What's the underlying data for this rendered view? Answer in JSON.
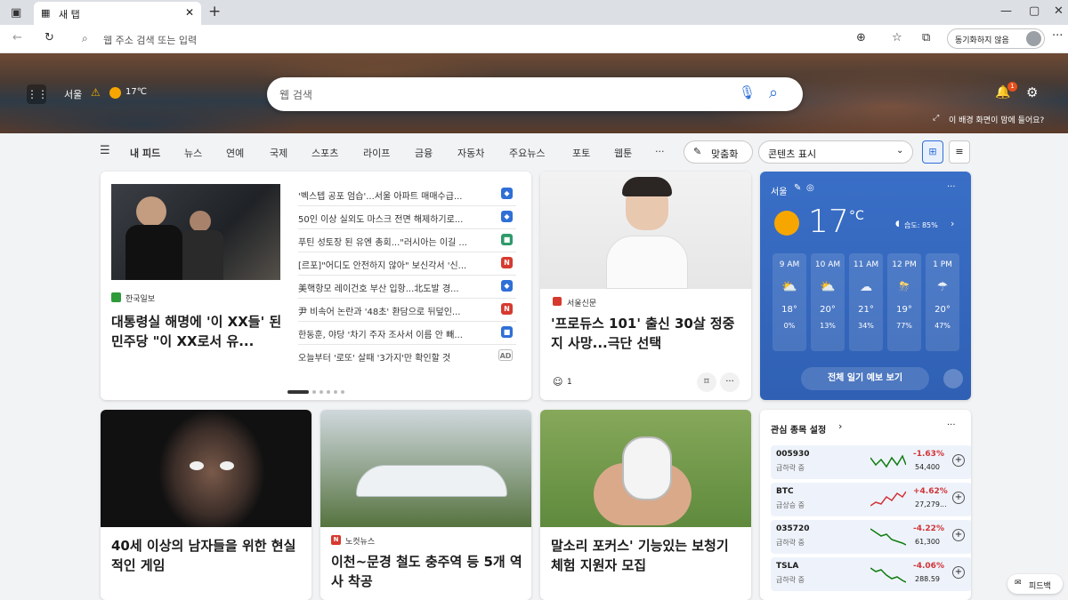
{
  "browser": {
    "tab_title": "새 탭",
    "url_placeholder": "웹 주소 검색 또는 입력",
    "sync_label": "동기화하지 않음"
  },
  "hero": {
    "location": "서울",
    "temperature": "17℃",
    "search_placeholder": "웹 검색",
    "notification_count": "1",
    "background_link": "이 배경 화면이 맘에 들어요?"
  },
  "nav": {
    "items": [
      "내 피드",
      "뉴스",
      "연예",
      "국제",
      "스포츠",
      "라이프",
      "금융",
      "자동차",
      "주요뉴스",
      "포토",
      "웹툰"
    ],
    "more": "···",
    "personalize_label": "맞춤화",
    "content_display_label": "콘텐츠 표시"
  },
  "main_card": {
    "source": "한국일보",
    "headline": "대통령실 해명에 '이 XX들' 된 민주당 \"이 XX로서 유...",
    "list": [
      {
        "text": "'벡스텝 공포 엄습'...서울 아파트 매매수급...",
        "source_color": "#2f6fd6",
        "source_icon": "shield-icon"
      },
      {
        "text": "50인 이상 실외도 마스크 전면 해제하기로...",
        "source_color": "#2f6fd6",
        "source_icon": "shield-icon"
      },
      {
        "text": "푸틴 성토장 된 유엔 총회...\"러시아는 이길 ...",
        "source_color": "#2e9a6a",
        "source_icon": "square-icon"
      },
      {
        "text": "[르포]\"어디도 안전하지 않아\" 보신각서 '신...",
        "source_color": "#d63a2f",
        "source_icon": "n-icon"
      },
      {
        "text": "美핵항모 레이건호 부산 입항...北도발 경...",
        "source_color": "#2f6fd6",
        "source_icon": "shield-icon"
      },
      {
        "text": "尹 비속어 논란과 '48초' 환담으로 뒤덮인...",
        "source_color": "#d63a2f",
        "source_icon": "n-icon"
      },
      {
        "text": "한동훈, 야당 '차기 주자 조사서 이름 안 빼...",
        "source_color": "#2f6fd6",
        "source_icon": "square-icon"
      },
      {
        "text": "오늘부터 '로또' 살때 '3가지'만 확인할 것",
        "source_color": "#999999",
        "source_icon": "ad-icon",
        "badge": "AD"
      }
    ]
  },
  "produce_card": {
    "source": "서울신문",
    "headline": "'프로듀스 101' 출신 30살 정중지 사망...극단 선택",
    "reactions": "1"
  },
  "weather": {
    "location": "서울",
    "temperature": "17",
    "unit": "°C",
    "precip_label": "습도: 85%",
    "hours": [
      {
        "time": "9 AM",
        "temp": "18°",
        "precip": "0%"
      },
      {
        "time": "10 AM",
        "temp": "20°",
        "precip": "13%"
      },
      {
        "time": "11 AM",
        "temp": "21°",
        "precip": "34%"
      },
      {
        "time": "12 PM",
        "temp": "19°",
        "precip": "77%"
      },
      {
        "time": "1 PM",
        "temp": "20°",
        "precip": "47%"
      }
    ],
    "forecast_button": "전체 일기 예보 보기"
  },
  "bottom_cards": [
    {
      "headline": "40세 이상의 남자들을 위한 현실적인 게임",
      "source": ""
    },
    {
      "headline": "이천~문경 철도 충주역 등 5개 역사 착공",
      "source": "노컷뉴스"
    },
    {
      "headline": "말소리 포커스' 기능있는 보청기 체험 지원자 모집",
      "source": ""
    }
  ],
  "stocks": {
    "title": "관심 종목 설정",
    "items": [
      {
        "symbol": "005930",
        "status": "급하락 중",
        "change": "-1.63%",
        "price": "54,400",
        "trend": "down"
      },
      {
        "symbol": "BTC",
        "status": "급상승 중",
        "change": "+4.62%",
        "price": "27,279...",
        "trend": "up"
      },
      {
        "symbol": "035720",
        "status": "급하락 중",
        "change": "-4.22%",
        "price": "61,300",
        "trend": "down"
      },
      {
        "symbol": "TSLA",
        "status": "급하락 중",
        "change": "-4.06%",
        "price": "288.59",
        "trend": "down"
      }
    ]
  },
  "feedback": {
    "label": "피드백"
  },
  "colors": {
    "accent": "#2f6fd6",
    "down": "#d13438",
    "up": "#107c10",
    "weather_bg": "#3a6fc7"
  }
}
